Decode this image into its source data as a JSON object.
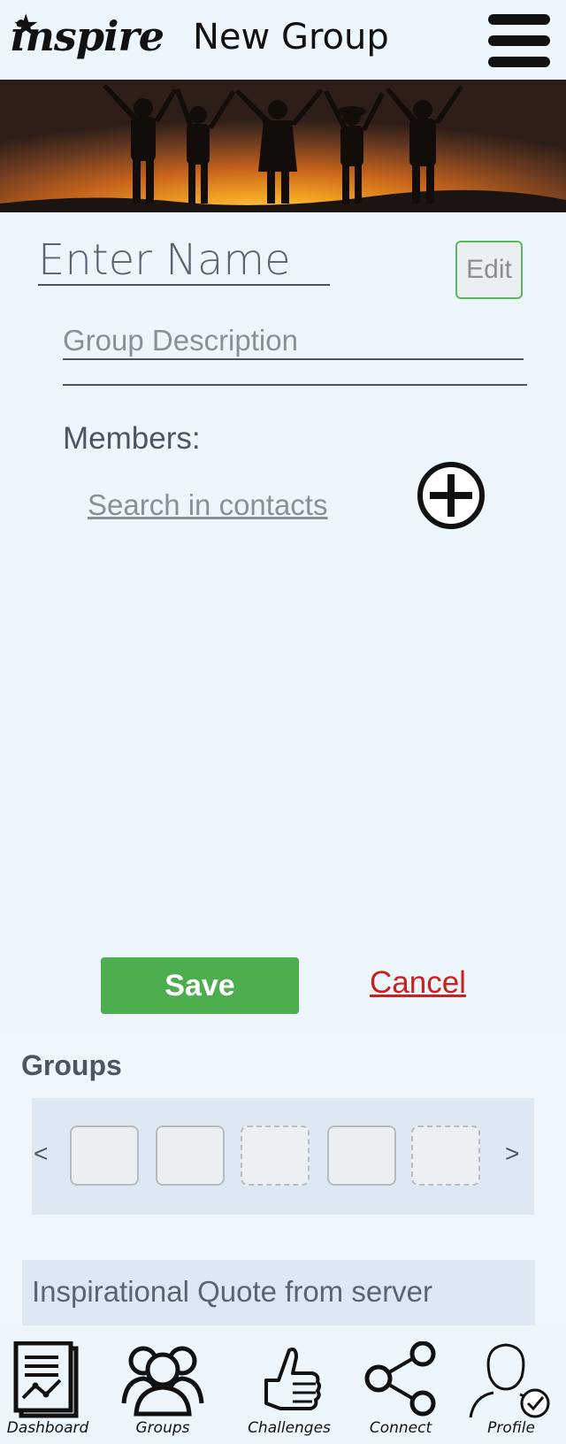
{
  "header": {
    "logo_text": "inspire",
    "title": "New Group",
    "menu_icon": "hamburger-menu-icon"
  },
  "form": {
    "name_placeholder": "Enter Name",
    "edit_label": "Edit",
    "description_placeholder": "Group Description",
    "members_label": "Members:",
    "search_placeholder": "Search in contacts",
    "add_icon": "plus-circle-icon"
  },
  "actions": {
    "save_label": "Save",
    "cancel_label": "Cancel"
  },
  "groups": {
    "heading": "Groups",
    "prev_label": "<",
    "next_label": ">",
    "thumbnails": [
      "solid",
      "solid",
      "dashed",
      "solid",
      "dashed"
    ]
  },
  "quote": {
    "text": "Inspirational Quote from server"
  },
  "bottom_nav": [
    {
      "label": "Dashboard",
      "icon": "dashboard-icon"
    },
    {
      "label": "Groups",
      "icon": "groups-icon"
    },
    {
      "label": "Challenges",
      "icon": "thumbs-up-icon"
    },
    {
      "label": "Connect",
      "icon": "share-nodes-icon"
    },
    {
      "label": "Profile",
      "icon": "profile-check-icon"
    }
  ],
  "colors": {
    "background": "#eef6fd",
    "save_green": "#4cae4f",
    "cancel_red": "#c9211e",
    "edit_border": "#5cb85c"
  }
}
